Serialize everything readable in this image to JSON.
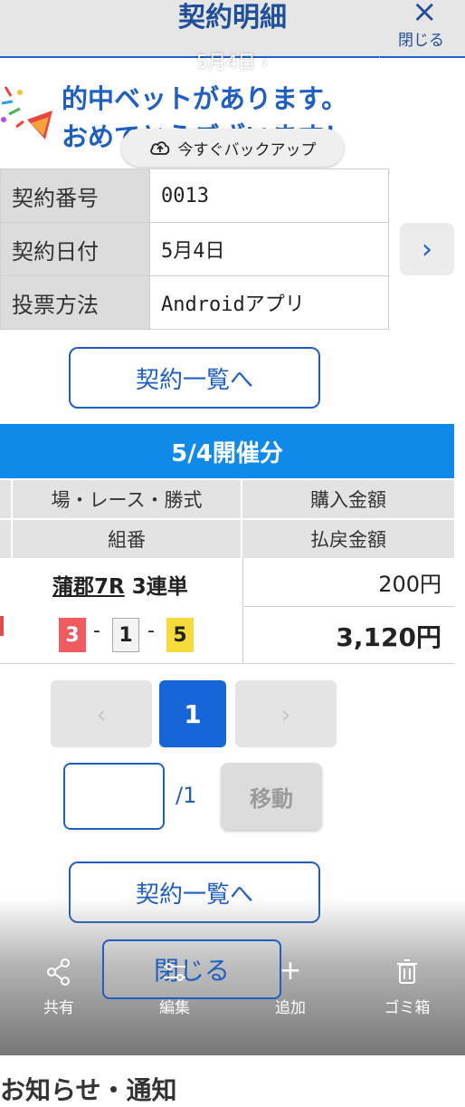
{
  "header": {
    "title": "契約明細",
    "close_label": "閉じる",
    "close_icon": "×"
  },
  "viewer": {
    "date": "5月4日",
    "time": "18:17"
  },
  "congrats": {
    "line1": "的中ベットがあります。",
    "line2": "おめでとうございます！"
  },
  "backup": {
    "label": "今すぐバックアップ"
  },
  "contract": {
    "rows": [
      {
        "label": "契約番号",
        "value": "0013"
      },
      {
        "label": "契約日付",
        "value": "5月4日"
      },
      {
        "label": "投票方法",
        "value": "Androidアプリ"
      }
    ]
  },
  "buttons": {
    "list_label": "契約一覧へ",
    "close_label": "閉じる",
    "move_label": "移動"
  },
  "day_banner": "5/4開催分",
  "bet_table": {
    "headers_row1": [
      "場・レース・勝式",
      "購入金額"
    ],
    "headers_row2": [
      "組番",
      "払戻金額"
    ],
    "venue": "蒲郡7R",
    "bet_type": "3連単",
    "combo": [
      "3",
      "1",
      "5"
    ],
    "separator": "-",
    "purchase": "200円",
    "payout": "3,120円"
  },
  "pager": {
    "prev": "‹",
    "current": "1",
    "next": "›",
    "total": "/1"
  },
  "toolbar": {
    "share": "共有",
    "edit": "編集",
    "add": "追加",
    "trash": "ゴミ箱"
  },
  "footer_clip": "お知らせ・通知"
}
